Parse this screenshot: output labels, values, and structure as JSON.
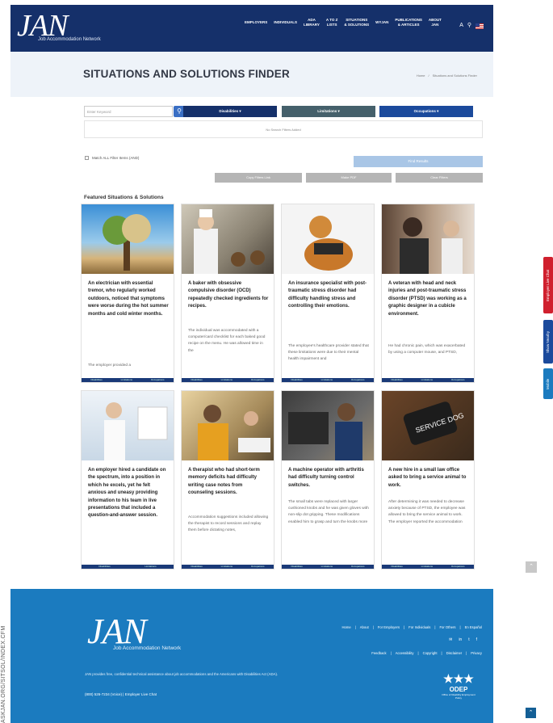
{
  "header": {
    "logo_text": "JAN",
    "logo_sub": "Job Accommodation Network",
    "nav": [
      "EMPLOYERS",
      "INDIVIDUALS",
      "ADA\nLIBRARY",
      "A TO Z\nLISTS",
      "SITUATIONS\n& SOLUTIONS",
      "WYJAN",
      "PUBLICATIONS\n& ARTICLES",
      "ABOUT\nJAN"
    ],
    "icons": [
      "text-size-icon",
      "search-icon",
      "us-flag-icon"
    ]
  },
  "title_band": {
    "title": "SITUATIONS AND SOLUTIONS FINDER",
    "crumbs": [
      "Home",
      "/",
      "Situations and Solutions Finder"
    ]
  },
  "filters": {
    "search_placeholder": "Enter Keyword",
    "dropdowns": [
      {
        "label": "Disabilities ▾",
        "color": "#15306a"
      },
      {
        "label": "Limitations ▾",
        "color": "#45606b"
      },
      {
        "label": "Occupations ▾",
        "color": "#1b4a9c"
      }
    ],
    "no_filters": "No Search Filters Added",
    "match_label": "Match ALL Filter Items (AND)",
    "find_label": "Find Results",
    "actions": [
      "Copy Filters Link",
      "Make PDF",
      "Clear Filters"
    ]
  },
  "featured_heading": "Featured Situations & Solutions",
  "cards": [
    {
      "title": "An electrician with essential tremor, who regularly worked outdoors, noticed that symptoms were worse during the hot summer months and cold winter months.",
      "desc": "The employer provided a"
    },
    {
      "title": "A baker with obsessive compulsive disorder (OCD) repeatedly checked ingredients for recipes.",
      "desc": "The individual was accommodated with a computer/card checklist for each baked good recipe on the menu. He was allowed time in the"
    },
    {
      "title": "An insurance specialist with post-traumatic stress disorder had difficulty handling stress and controlling their emotions.",
      "desc": "The employee's healthcare provider stated that these limitations were due to their mental health impairment and"
    },
    {
      "title": "A veteran with head and neck injuries and post-traumatic stress disorder (PTSD) was working as a graphic designer in a cubicle environment.",
      "desc": "He had chronic pain, which was exacerbated by using a computer mouse, and PTSD,"
    },
    {
      "title": "An employer hired a candidate on the spectrum, into a position in which he excels, yet he felt anxious and uneasy providing information to his team in live presentations that included a question-and-answer session.",
      "desc": ""
    },
    {
      "title": "A therapist who had short-term memory deficits had difficulty writing case notes from counseling sessions.",
      "desc": "Accommodation suggestions included allowing the therapist to record sessions and replay them before dictating notes,"
    },
    {
      "title": "A machine operator with arthritis had difficulty turning control switches.",
      "desc": "The small tabs were replaced with larger cushioned knobs and he was given gloves with non-slip dot gripping. These modifications enabled him to grasp and turn the knobs more"
    },
    {
      "title": "A new hire in a small law office asked to bring a service animal to work.",
      "desc": "After determining it was needed to decrease anxiety because of PTSD, the employee was allowed to bring the service animal to work. The employer reported the accommodation"
    }
  ],
  "card_bar": [
    "Disabilities",
    "Limitations",
    "Occupations"
  ],
  "side_tabs": [
    {
      "label": "Employer Live Chat",
      "color": "#d0202e"
    },
    {
      "label": "Show Nearby",
      "color": "#1b4a9c"
    },
    {
      "label": "Mobile",
      "color": "#1b7bbf"
    }
  ],
  "footer": {
    "logo_text": "JAN",
    "logo_sub": "Job Accommodation Network",
    "desc": "JAN provides free, confidential technical assistance about job accommodations and the Americans with Disabilities Act (ADA).",
    "contact": "(800) 526-7234 (Voice)  |  Employer Live Chat",
    "links1": [
      "Home",
      "|",
      "About",
      "|",
      "For Employers",
      "|",
      "For Individuals",
      "|",
      "For Others",
      "|",
      "En Español"
    ],
    "social": [
      "✉",
      "in",
      "t",
      "f"
    ],
    "links2": [
      "Feedback",
      "|",
      "Accessibility",
      "|",
      "Copyright",
      "|",
      "Disclaimer",
      "|",
      "Privacy"
    ],
    "odep_mark": "★★★",
    "odep_label": "ODEP",
    "odep_sub": "Office of Disability Employment Policy"
  },
  "margin_url": "ASKJAN.ORG/SITSOL/INDEX.CFM"
}
